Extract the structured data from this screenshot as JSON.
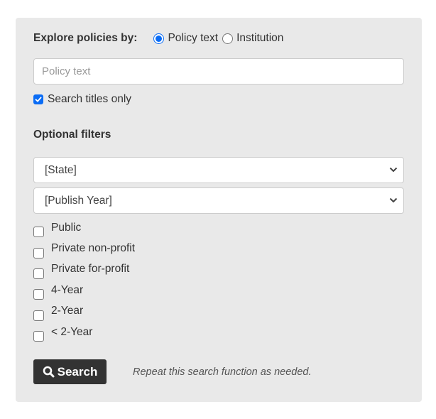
{
  "explore": {
    "label": "Explore policies by:",
    "options": [
      {
        "label": "Policy text",
        "checked": true
      },
      {
        "label": "Institution",
        "checked": false
      }
    ]
  },
  "search": {
    "placeholder": "Policy text",
    "value": "",
    "titles_only": {
      "label": "Search titles only",
      "checked": true
    }
  },
  "filters": {
    "heading": "Optional filters",
    "state_select": {
      "selected": "[State]"
    },
    "year_select": {
      "selected": "[Publish Year]"
    },
    "checkboxes": [
      {
        "label": "Public",
        "checked": false
      },
      {
        "label": "Private non-profit",
        "checked": false
      },
      {
        "label": "Private for-profit",
        "checked": false
      },
      {
        "label": "4-Year",
        "checked": false
      },
      {
        "label": "2-Year",
        "checked": false
      },
      {
        "label": "< 2-Year",
        "checked": false
      }
    ]
  },
  "actions": {
    "search_label": "Search",
    "search_icon": "magnifier-icon",
    "hint": "Repeat this search function as needed."
  },
  "colors": {
    "accent": "#0a6cf5",
    "panel_bg": "#e9e9e9",
    "button_bg": "#333333"
  }
}
